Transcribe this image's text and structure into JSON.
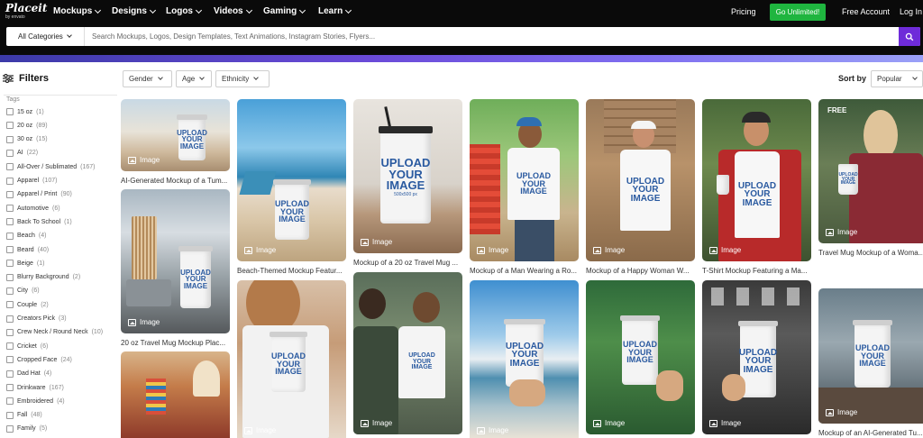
{
  "nav": {
    "logo_main": "Placeit",
    "logo_sub": "by envato",
    "items": [
      "Mockups",
      "Designs",
      "Logos",
      "Videos",
      "Gaming",
      "Learn"
    ],
    "pricing": "Pricing",
    "cta": "Go Unlimited!",
    "free_account": "Free Account",
    "login": "Log In"
  },
  "search": {
    "category": "All Categories",
    "placeholder": "Search Mockups, Logos, Design Templates, Text Animations, Instagram Stories, Flyers..."
  },
  "filters": {
    "title": "Filters",
    "tags_title": "Tags",
    "tags": [
      {
        "label": "15 oz",
        "count": "(1)"
      },
      {
        "label": "20 oz",
        "count": "(89)"
      },
      {
        "label": "30 oz",
        "count": "(15)"
      },
      {
        "label": "AI",
        "count": "(22)"
      },
      {
        "label": "All-Over / Sublimated",
        "count": "(167)"
      },
      {
        "label": "Apparel",
        "count": "(107)"
      },
      {
        "label": "Apparel / Print",
        "count": "(90)"
      },
      {
        "label": "Automotive",
        "count": "(6)"
      },
      {
        "label": "Back To School",
        "count": "(1)"
      },
      {
        "label": "Beach",
        "count": "(4)"
      },
      {
        "label": "Beard",
        "count": "(40)"
      },
      {
        "label": "Beige",
        "count": "(1)"
      },
      {
        "label": "Blurry Background",
        "count": "(2)"
      },
      {
        "label": "City",
        "count": "(6)"
      },
      {
        "label": "Couple",
        "count": "(2)"
      },
      {
        "label": "Creators Pick",
        "count": "(3)"
      },
      {
        "label": "Crew Neck / Round Neck",
        "count": "(10)"
      },
      {
        "label": "Cricket",
        "count": "(6)"
      },
      {
        "label": "Cropped Face",
        "count": "(24)"
      },
      {
        "label": "Dad Hat",
        "count": "(4)"
      },
      {
        "label": "Drinkware",
        "count": "(167)"
      },
      {
        "label": "Embroidered",
        "count": "(4)"
      },
      {
        "label": "Fall",
        "count": "(48)"
      },
      {
        "label": "Family",
        "count": "(5)"
      }
    ]
  },
  "toolbar": {
    "gender": "Gender",
    "age": "Age",
    "ethnicity": "Ethnicity",
    "sort_label": "Sort by",
    "sort_value": "Popular"
  },
  "cards": {
    "image_label": "Image",
    "upload_line1": "UPLOAD",
    "upload_line2": "YOUR",
    "upload_line3": "IMAGE",
    "upload_size": "500x500 px",
    "free_label": "FREE",
    "captions": [
      "AI-Generated Mockup of a Tum...",
      "20 oz Travel Mug Mockup Plac...",
      "Beach-Themed Mockup Featur...",
      "Mockup of a 20 oz Travel Mug ...",
      "Mockup of a Man Wearing a Ro...",
      "Mockup of a Happy Woman W...",
      "T-Shirt Mockup Featuring a Ma...",
      "Travel Mug Mockup of a Woma...",
      "Mockup of an AI-Generated Tu..."
    ]
  },
  "colors": {
    "nav_bg": "#0a0a0a",
    "cta_green": "#1fb53f",
    "search_purple": "#6e2bd9"
  }
}
